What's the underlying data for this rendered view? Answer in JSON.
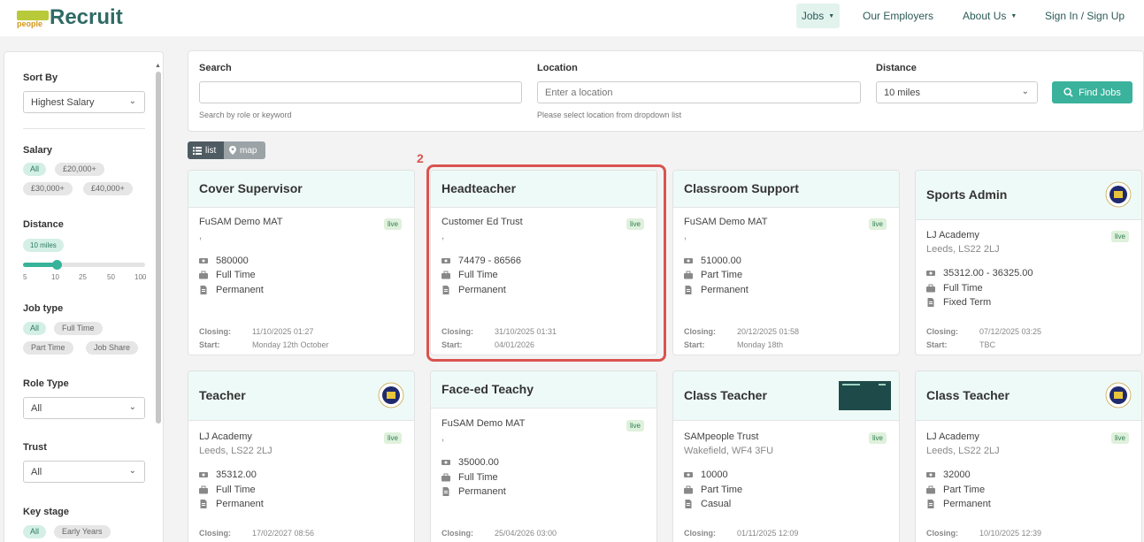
{
  "header": {
    "logo_people": "people",
    "logo_text": "Recruit",
    "nav": [
      {
        "label": "Jobs",
        "caret": true
      },
      {
        "label": "Our Employers",
        "caret": false
      },
      {
        "label": "About Us",
        "caret": true
      },
      {
        "label": "Sign In / Sign Up",
        "caret": false
      }
    ]
  },
  "sidebar": {
    "sort_by_label": "Sort By",
    "sort_by_value": "Highest Salary",
    "salary_label": "Salary",
    "salary_pills": [
      "All",
      "£20,000+",
      "£30,000+",
      "£40,000+"
    ],
    "distance_label": "Distance",
    "distance_value": "10 miles",
    "distance_ticks": [
      "5",
      "10",
      "25",
      "50",
      "100"
    ],
    "distance_slider_fraction": 0.27,
    "job_type_label": "Job type",
    "job_type_pills": [
      "All",
      "Full Time",
      "Part Time",
      "Job Share"
    ],
    "role_type_label": "Role Type",
    "role_type_value": "All",
    "trust_label": "Trust",
    "trust_value": "All",
    "key_stage_label": "Key stage",
    "key_stage_pills": [
      "All",
      "Early Years"
    ]
  },
  "search": {
    "search_label": "Search",
    "search_value": "",
    "search_help": "Search by role or keyword",
    "location_label": "Location",
    "location_placeholder": "Enter a location",
    "location_help": "Please select location from dropdown list",
    "distance_label": "Distance",
    "distance_value": "10 miles",
    "find_button": "Find Jobs"
  },
  "view_toggle": {
    "list": "list",
    "map": "map"
  },
  "annotation": {
    "number": "2"
  },
  "jobs": [
    {
      "title": "Cover Supervisor",
      "employer": "FuSAM Demo MAT",
      "location": ",",
      "status": "live",
      "salary": "580000",
      "hours": "Full Time",
      "contract": "Permanent",
      "closing_label": "Closing:",
      "closing": "11/10/2025 01:27",
      "start_label": "Start:",
      "start": "Monday 12th October"
    },
    {
      "title": "Headteacher",
      "employer": "Customer Ed Trust",
      "location": ",",
      "status": "live",
      "salary": "74479 - 86566",
      "hours": "Full Time",
      "contract": "Permanent",
      "closing_label": "Closing:",
      "closing": "31/10/2025 01:31",
      "start_label": "Start:",
      "start": "04/01/2026"
    },
    {
      "title": "Classroom Support",
      "employer": "FuSAM Demo MAT",
      "location": ",",
      "status": "live",
      "salary": "51000.00",
      "hours": "Part Time",
      "contract": "Permanent",
      "closing_label": "Closing:",
      "closing": "20/12/2025 01:58",
      "start_label": "Start:",
      "start": "Monday 18th"
    },
    {
      "title": "Sports Admin",
      "employer": "LJ Academy",
      "location": "Leeds, LS22 2LJ",
      "status": "live",
      "salary": "35312.00 - 36325.00",
      "hours": "Full Time",
      "contract": "Fixed Term",
      "closing_label": "Closing:",
      "closing": "07/12/2025 03:25",
      "start_label": "Start:",
      "start": "TBC"
    },
    {
      "title": "Teacher",
      "employer": "LJ Academy",
      "location": "Leeds, LS22 2LJ",
      "status": "live",
      "salary": "35312.00",
      "hours": "Full Time",
      "contract": "Permanent",
      "closing_label": "Closing:",
      "closing": "17/02/2027 08:56"
    },
    {
      "title": "Face-ed Teachy",
      "employer": "FuSAM Demo MAT",
      "location": ",",
      "status": "live",
      "salary": "35000.00",
      "hours": "Full Time",
      "contract": "Permanent",
      "closing_label": "Closing:",
      "closing": "25/04/2026 03:00"
    },
    {
      "title": "Class Teacher",
      "employer": "SAMpeople Trust",
      "location": "Wakefield, WF4 3FU",
      "status": "live",
      "salary": "10000",
      "hours": "Part Time",
      "contract": "Casual",
      "closing_label": "Closing:",
      "closing": "01/11/2025 12:09"
    },
    {
      "title": "Class Teacher",
      "employer": "LJ Academy",
      "location": "Leeds, LS22 2LJ",
      "status": "live",
      "salary": "32000",
      "hours": "Part Time",
      "contract": "Permanent",
      "closing_label": "Closing:",
      "closing": "10/10/2025 12:39"
    }
  ],
  "colors": {
    "accent": "#3ab29c",
    "brand": "#2f6b64",
    "highlight": "#d9534f",
    "card_header": "#eefaf7"
  }
}
